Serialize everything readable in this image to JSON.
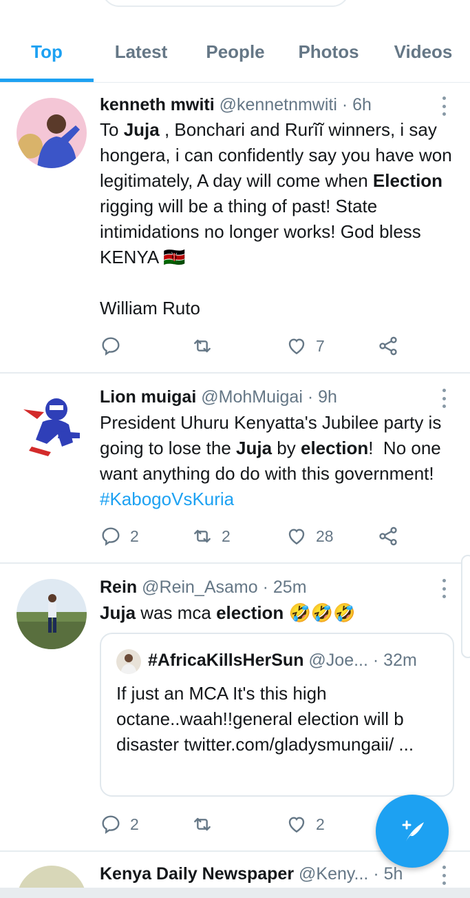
{
  "tabs": [
    {
      "label": "Top",
      "active": true
    },
    {
      "label": "Latest",
      "active": false
    },
    {
      "label": "People",
      "active": false
    },
    {
      "label": "Photos",
      "active": false
    },
    {
      "label": "Videos",
      "active": false
    }
  ],
  "colors": {
    "accent": "#1da1f2",
    "muted": "#657786",
    "divider": "#e6ecf0"
  },
  "tweets": [
    {
      "name": "kenneth mwiti",
      "handle": "@kennetnmwiti",
      "time": "· 6h",
      "body": {
        "p1": "To ",
        "b1": "Juja",
        "p2": " , Bonchari and Rurĩĩ winners, i say hongera, i can confidently say you have won legitimately, A day will come when ",
        "b2": "Election",
        "p3": " rigging will be a thing of past! State intimidations no longer works! God bless KENYA 🇰🇪",
        "p4": "William Ruto"
      },
      "actions": {
        "reply": "",
        "retweet": "",
        "like": "7"
      }
    },
    {
      "name": "Lion muigai",
      "handle": "@MohMuigai",
      "time": "· 9h",
      "body": {
        "p1": "President Uhuru Kenyatta's Jubilee party is going to lose the ",
        "b1": "Juja",
        "p2": " by ",
        "b2": "election",
        "p3": "!  No one want anything do do with this government!   ",
        "hashtag": "#KabogoVsKuria"
      },
      "actions": {
        "reply": "2",
        "retweet": "2",
        "like": "28"
      }
    },
    {
      "name": "Rein",
      "handle": "@Rein_Asamo",
      "time": "· 25m",
      "body": {
        "b1": "Juja",
        "p1": " was mca ",
        "b2": "election",
        "p2": " 🤣🤣🤣"
      },
      "quote": {
        "name": "#AfricaKillsHerSun",
        "handle": "@Joe...",
        "time": "· 32m",
        "body": "If just an MCA It's this high octane..waah!!general election will b disaster twitter.com/gladysmungaii/ ..."
      },
      "actions": {
        "reply": "2",
        "retweet": "",
        "like": "2"
      }
    },
    {
      "name": "Kenya Daily Newspaper",
      "handle": "@Keny...",
      "time": "· 5h"
    }
  ],
  "icons": {
    "reply": "reply-icon",
    "retweet": "retweet-icon",
    "like": "heart-icon",
    "share": "share-icon",
    "compose": "compose-tweet-icon",
    "more": "more-vertical-icon"
  }
}
